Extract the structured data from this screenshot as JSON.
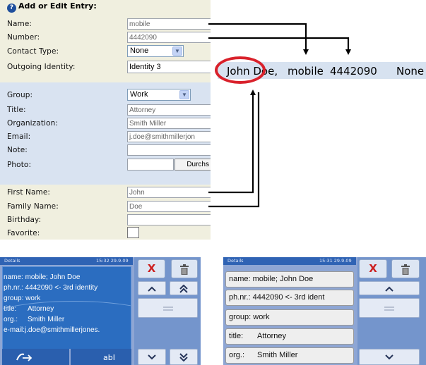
{
  "form": {
    "title": "Add or Edit Entry:",
    "help_icon": "?",
    "fields": {
      "name": {
        "label": "Name:",
        "value": "mobile"
      },
      "number": {
        "label": "Number:",
        "value": "4442090"
      },
      "contact_type": {
        "label": "Contact Type:",
        "value": "None"
      },
      "outgoing_identity": {
        "label": "Outgoing Identity:",
        "value": "Identity 3"
      },
      "group": {
        "label": "Group:",
        "value": "Work"
      },
      "title": {
        "label": "Title:",
        "value": "Attorney"
      },
      "organization": {
        "label": "Organization:",
        "value": "Smith Miller"
      },
      "email": {
        "label": "Email:",
        "value": "j.doe@smithmillerjon"
      },
      "note": {
        "label": "Note:",
        "value": ""
      },
      "photo": {
        "label": "Photo:",
        "value": "",
        "button": "Durchs"
      },
      "first_name": {
        "label": "First Name:",
        "value": "John"
      },
      "family_name": {
        "label": "Family Name:",
        "value": "Doe"
      },
      "birthday": {
        "label": "Birthday:",
        "value": ""
      },
      "favorite": {
        "label": "Favorite:",
        "checked": false
      }
    },
    "colors": {
      "cream": "#f0efdf",
      "blue": "#d9e3f1"
    }
  },
  "result_line": {
    "name": "John Doe,",
    "type": "mobile",
    "number": "4442090",
    "contact_type": "None",
    "highlight_color": "#d9212b"
  },
  "device_left": {
    "header": "Details",
    "time": "15:32  29.9.09",
    "lines": [
      {
        "key": "name:",
        "value": "mobile; John Doe"
      },
      {
        "key": "ph.nr.:",
        "value": "4442090 <- 3rd identity"
      },
      {
        "key": "group:",
        "value": "work"
      },
      {
        "key": "title:",
        "value": "Attorney"
      },
      {
        "key": "org.:",
        "value": "Smith Miller"
      },
      {
        "key": "e-mail:",
        "value": "j.doe@smithmillerjones."
      }
    ],
    "bottom_right": "abI",
    "buttons": {
      "close": "X",
      "trash": "trash-icon"
    }
  },
  "device_right": {
    "header": "Details",
    "time": "15:31  29.9.09",
    "lines": [
      {
        "key": "name:",
        "value": "mobile; John Doe"
      },
      {
        "key": "ph.nr.:",
        "value": "4442090 <- 3rd ident"
      },
      {
        "key": "group:",
        "value": "work"
      },
      {
        "key": "title:",
        "value": "Attorney"
      },
      {
        "key": "org.:",
        "value": "Smith Miller"
      }
    ],
    "buttons": {
      "close": "X",
      "trash": "trash-icon"
    }
  }
}
